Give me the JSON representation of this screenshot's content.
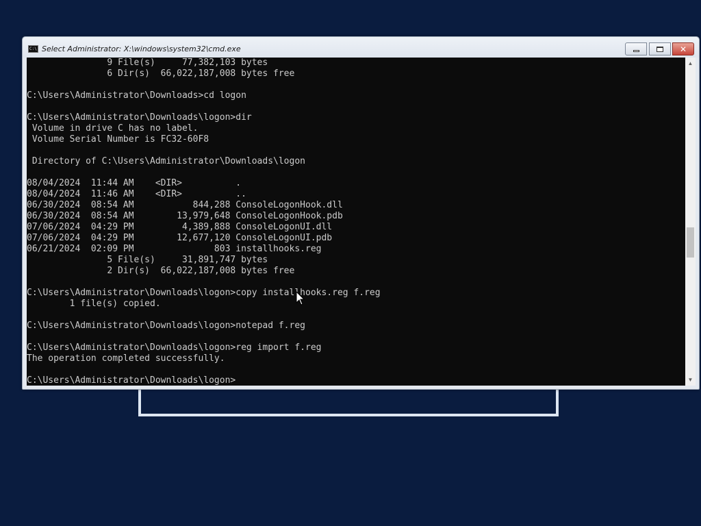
{
  "window": {
    "title": "Select Administrator: X:\\windows\\system32\\cmd.exe",
    "icon": "cmd-icon",
    "icon_text": "C:\\",
    "controls": {
      "minimize": "minimize-icon",
      "maximize": "maximize-icon",
      "close": "close-icon",
      "close_glyph": "✕"
    }
  },
  "console": {
    "lines": [
      "               9 File(s)     77,382,103 bytes",
      "               6 Dir(s)  66,022,187,008 bytes free",
      "",
      "C:\\Users\\Administrator\\Downloads>cd logon",
      "",
      "C:\\Users\\Administrator\\Downloads\\logon>dir",
      " Volume in drive C has no label.",
      " Volume Serial Number is FC32-60F8",
      "",
      " Directory of C:\\Users\\Administrator\\Downloads\\logon",
      "",
      "08/04/2024  11:44 AM    <DIR>          .",
      "08/04/2024  11:46 AM    <DIR>          ..",
      "06/30/2024  08:54 AM           844,288 ConsoleLogonHook.dll",
      "06/30/2024  08:54 AM        13,979,648 ConsoleLogonHook.pdb",
      "07/06/2024  04:29 PM         4,389,888 ConsoleLogonUI.dll",
      "07/06/2024  04:29 PM        12,677,120 ConsoleLogonUI.pdb",
      "06/21/2024  02:09 PM               803 installhooks.reg",
      "               5 File(s)     31,891,747 bytes",
      "               2 Dir(s)  66,022,187,008 bytes free",
      "",
      "C:\\Users\\Administrator\\Downloads\\logon>copy installhooks.reg f.reg",
      "        1 file(s) copied.",
      "",
      "C:\\Users\\Administrator\\Downloads\\logon>notepad f.reg",
      "",
      "C:\\Users\\Administrator\\Downloads\\logon>reg import f.reg",
      "The operation completed successfully.",
      "",
      "C:\\Users\\Administrator\\Downloads\\logon>"
    ]
  },
  "scrollbar": {
    "up_glyph": "▲",
    "down_glyph": "▼"
  },
  "colors": {
    "desktop": "#0a1c3f",
    "console_bg": "#0c0c0c",
    "console_fg": "#cccccc",
    "close_button": "#c6453a"
  }
}
